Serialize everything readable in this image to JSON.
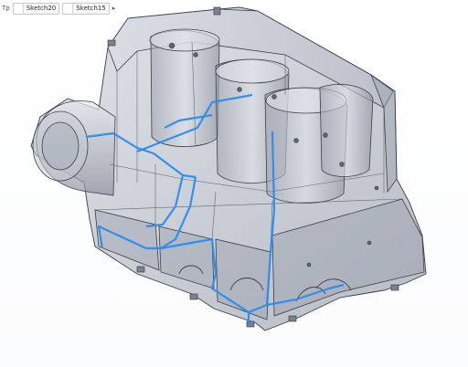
{
  "breadcrumb": {
    "first": "Tp",
    "items": [
      {
        "label": "Sketch20",
        "icon": "sketch-icon"
      },
      {
        "label": "Sketch15",
        "icon": "sketch-icon"
      }
    ],
    "expand_icon": "chevron-right-icon"
  },
  "model": {
    "view": "isometric",
    "display_mode": "transparent shaded with edges",
    "highlight_color": "#2a8cf0",
    "body_color": "#8e96a4"
  }
}
